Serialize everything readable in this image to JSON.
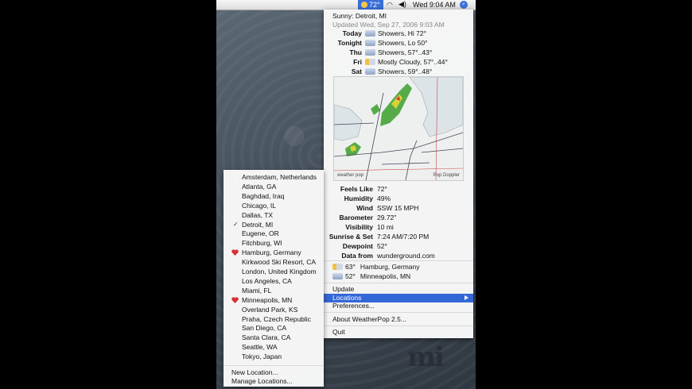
{
  "menubar": {
    "temp": "72°",
    "clock": "Wed 9:04 AM"
  },
  "forecast": {
    "header": "Sunny: Detroit, MI",
    "updated": "Updated Wed, Sep 27, 2006 9:03 AM",
    "days": [
      {
        "label": "Today",
        "icon": "rain-icon",
        "text": "Showers, Hi 72°"
      },
      {
        "label": "Tonight",
        "icon": "rain-icon",
        "text": "Showers, Lo 50°"
      },
      {
        "label": "Thu",
        "icon": "rain-icon",
        "text": "Showers, 57°..43°"
      },
      {
        "label": "Fri",
        "icon": "cloud-icon",
        "text": "Mostly Cloudy, 57°..44°"
      },
      {
        "label": "Sat",
        "icon": "rain-icon",
        "text": "Showers, 59°..48°"
      }
    ]
  },
  "radar": {
    "left_caption": "weather pop",
    "right_caption": "Pop Doppler"
  },
  "details": [
    {
      "label": "Feels Like",
      "value": "72°"
    },
    {
      "label": "Humidity",
      "value": "49%"
    },
    {
      "label": "Wind",
      "value": "SSW 15 MPH"
    },
    {
      "label": "Barometer",
      "value": "29.72\""
    },
    {
      "label": "Visibility",
      "value": "10 mi"
    },
    {
      "label": "Sunrise & Set",
      "value": "7:24 AM/7:20 PM"
    },
    {
      "label": "Dewpoint",
      "value": "52°"
    },
    {
      "label": "Data from",
      "value": "wunderground.com"
    }
  ],
  "other_locations": [
    {
      "temp": "63°",
      "name": "Hamburg, Germany"
    },
    {
      "temp": "52°",
      "name": "Minneapolis, MN"
    }
  ],
  "menu_items": {
    "update": "Update",
    "locations": "Locations",
    "preferences": "Preferences...",
    "about": "About WeatherPop 2.5...",
    "quit": "Quit"
  },
  "locations": [
    "Amsterdam, Netherlands",
    "Atlanta, GA",
    "Baghdad, Iraq",
    "Chicago, IL",
    "Dallas, TX",
    "Detroit, MI",
    "Eugene, OR",
    "Fitchburg, WI",
    "Hamburg, Germany",
    "Kirkwood Ski Resort, CA",
    "London, United Kingdom",
    "Los Angeles, CA",
    "Miami, FL",
    "Minneapolis, MN",
    "Overland Park, KS",
    "Praha, Czech Republic",
    "San Diego, CA",
    "Santa Clara, CA",
    "Seattle, WA",
    "Tokyo, Japan"
  ],
  "locations_checked": "Detroit, MI",
  "locations_favorites": [
    "Hamburg, Germany",
    "Minneapolis, MN"
  ],
  "location_actions": {
    "new": "New Location...",
    "manage": "Manage Locations..."
  },
  "colors": {
    "highlight": "#3467d6",
    "heart": "#d83030"
  }
}
